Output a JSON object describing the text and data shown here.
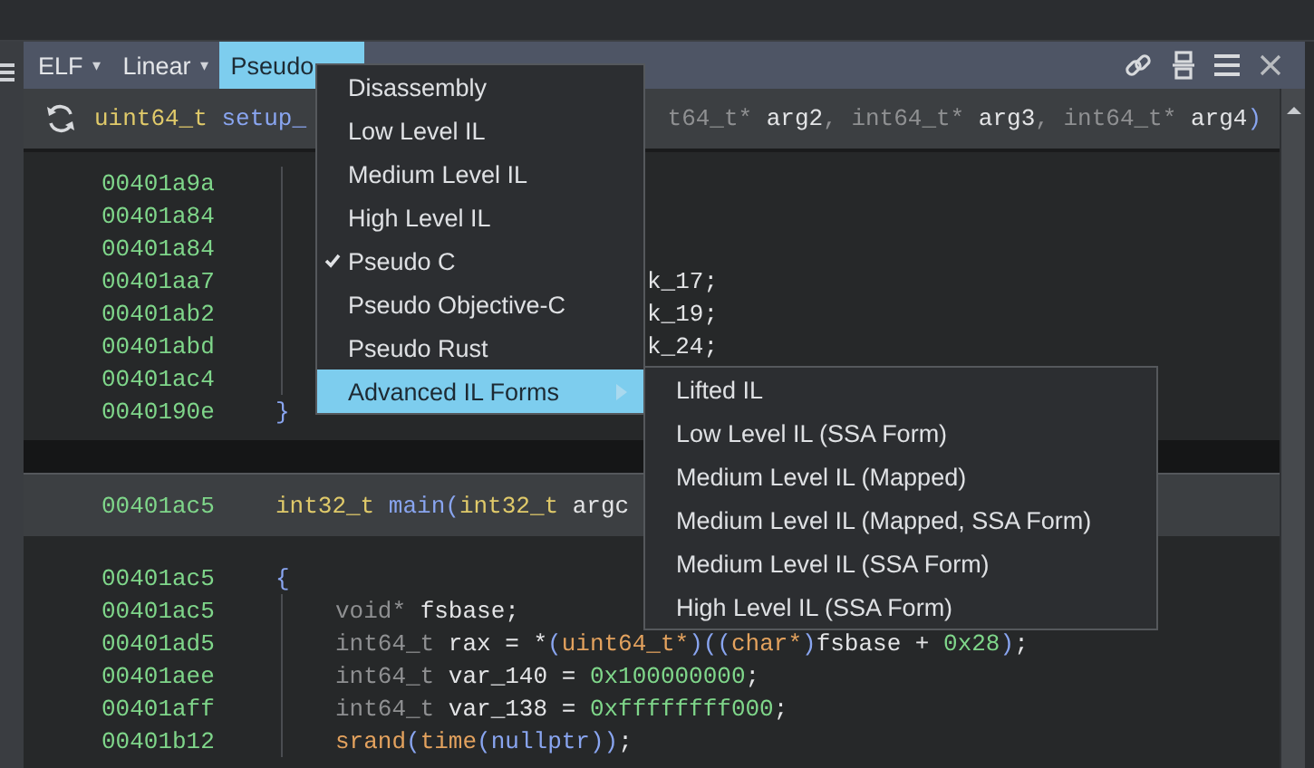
{
  "tabs": [
    {
      "label": "ELF",
      "caret": "▾",
      "selected": false
    },
    {
      "label": "Linear",
      "caret": "▾",
      "selected": false
    },
    {
      "label": "Pseudo",
      "selected": true
    }
  ],
  "functions": [
    {
      "header": {
        "left": [
          {
            "text": "uint64_t",
            "kind": "type"
          },
          {
            "text": " setup_",
            "kind": "name"
          }
        ],
        "right": [
          {
            "text": "t64_t*",
            "kind": "ptype"
          },
          {
            "text": " arg2",
            "kind": "var"
          },
          {
            "text": ", ",
            "kind": "ptype"
          },
          {
            "text": "int64_t*",
            "kind": "ptype"
          },
          {
            "text": " arg3",
            "kind": "var"
          },
          {
            "text": ", ",
            "kind": "ptype"
          },
          {
            "text": "int64_t*",
            "kind": "ptype"
          },
          {
            "text": " arg4",
            "kind": "var"
          },
          {
            "text": ")",
            "kind": "paren"
          }
        ]
      },
      "body": [
        {
          "address": "00401a9a"
        },
        {
          "address": "00401a84"
        },
        {
          "address": "00401a84"
        },
        {
          "address": "00401aa7",
          "covered": true,
          "tokens": [
            {
              "text": "k_17;",
              "kind": "var"
            }
          ]
        },
        {
          "address": "00401ab2",
          "covered": true,
          "tokens": [
            {
              "text": "k_19;",
              "kind": "var"
            }
          ]
        },
        {
          "address": "00401abd",
          "covered": true,
          "tokens": [
            {
              "text": "k_24;",
              "kind": "var"
            }
          ]
        },
        {
          "address": "00401ac4"
        }
      ],
      "close": {
        "address": "0040190e",
        "tokens": [
          {
            "text": "}",
            "kind": "paren"
          }
        ]
      }
    },
    {
      "header": {
        "address": "00401ac5",
        "left": [
          {
            "text": "int32_t",
            "kind": "type"
          },
          {
            "text": " main",
            "kind": "name"
          },
          {
            "text": "(",
            "kind": "paren"
          },
          {
            "text": "int32_t",
            "kind": "type"
          },
          {
            "text": " argc",
            "kind": "var"
          }
        ]
      },
      "open": {
        "address": "00401ac5",
        "tokens": [
          {
            "text": "{",
            "kind": "paren"
          }
        ]
      },
      "body": [
        {
          "address": "00401ac5",
          "tokens": [
            {
              "text": "void*",
              "kind": "ptype"
            },
            {
              "text": " fsbase;",
              "kind": "var"
            }
          ]
        },
        {
          "address": "00401ad5",
          "tokens": [
            {
              "text": "int64_t",
              "kind": "ptype"
            },
            {
              "text": " rax = *",
              "kind": "var"
            },
            {
              "text": "(",
              "kind": "paren"
            },
            {
              "text": "uint64_t*",
              "kind": "call"
            },
            {
              "text": ")(",
              "kind": "paren"
            },
            {
              "text": "(",
              "kind": "paren"
            },
            {
              "text": "char*",
              "kind": "call"
            },
            {
              "text": ")",
              "kind": "paren"
            },
            {
              "text": "fsbase + ",
              "kind": "var"
            },
            {
              "text": "0x28",
              "kind": "num"
            },
            {
              "text": ")",
              "kind": "paren"
            },
            {
              "text": ";",
              "kind": "var"
            }
          ]
        },
        {
          "address": "00401aee",
          "tokens": [
            {
              "text": "int64_t",
              "kind": "ptype"
            },
            {
              "text": " var_140 = ",
              "kind": "var"
            },
            {
              "text": "0x100000000",
              "kind": "num"
            },
            {
              "text": ";",
              "kind": "var"
            }
          ]
        },
        {
          "address": "00401aff",
          "tokens": [
            {
              "text": "int64_t",
              "kind": "ptype"
            },
            {
              "text": " var_138 = ",
              "kind": "var"
            },
            {
              "text": "0xffffffff000",
              "kind": "num"
            },
            {
              "text": ";",
              "kind": "var"
            }
          ]
        },
        {
          "address": "00401b12",
          "tokens": [
            {
              "text": "srand",
              "kind": "call"
            },
            {
              "text": "(",
              "kind": "paren"
            },
            {
              "text": "time",
              "kind": "call"
            },
            {
              "text": "(",
              "kind": "paren"
            },
            {
              "text": "nullptr",
              "kind": "name"
            },
            {
              "text": "))",
              "kind": "paren"
            },
            {
              "text": ";",
              "kind": "var"
            }
          ]
        }
      ]
    }
  ],
  "menu": {
    "items": [
      {
        "label": "Disassembly",
        "checked": false,
        "selected": false
      },
      {
        "label": "Low Level IL",
        "checked": false,
        "selected": false
      },
      {
        "label": "Medium Level IL",
        "checked": false,
        "selected": false
      },
      {
        "label": "High Level IL",
        "checked": false,
        "selected": false
      },
      {
        "label": "Pseudo C",
        "checked": true,
        "selected": false
      },
      {
        "label": "Pseudo Objective-C",
        "checked": false,
        "selected": false
      },
      {
        "label": "Pseudo Rust",
        "checked": false,
        "selected": false
      },
      {
        "label": "Advanced IL Forms",
        "checked": false,
        "selected": true,
        "submenu": true
      }
    ]
  },
  "submenu": {
    "items": [
      {
        "label": "Lifted IL",
        "selected": false
      },
      {
        "label": "Low Level IL (SSA Form)",
        "selected": false
      },
      {
        "label": "Medium Level IL (Mapped)",
        "selected": false
      },
      {
        "label": "Medium Level IL (Mapped, SSA Form)",
        "selected": false
      },
      {
        "label": "Medium Level IL (SSA Form)",
        "selected": false
      },
      {
        "label": "High Level IL (SSA Form)",
        "selected": false
      }
    ]
  }
}
